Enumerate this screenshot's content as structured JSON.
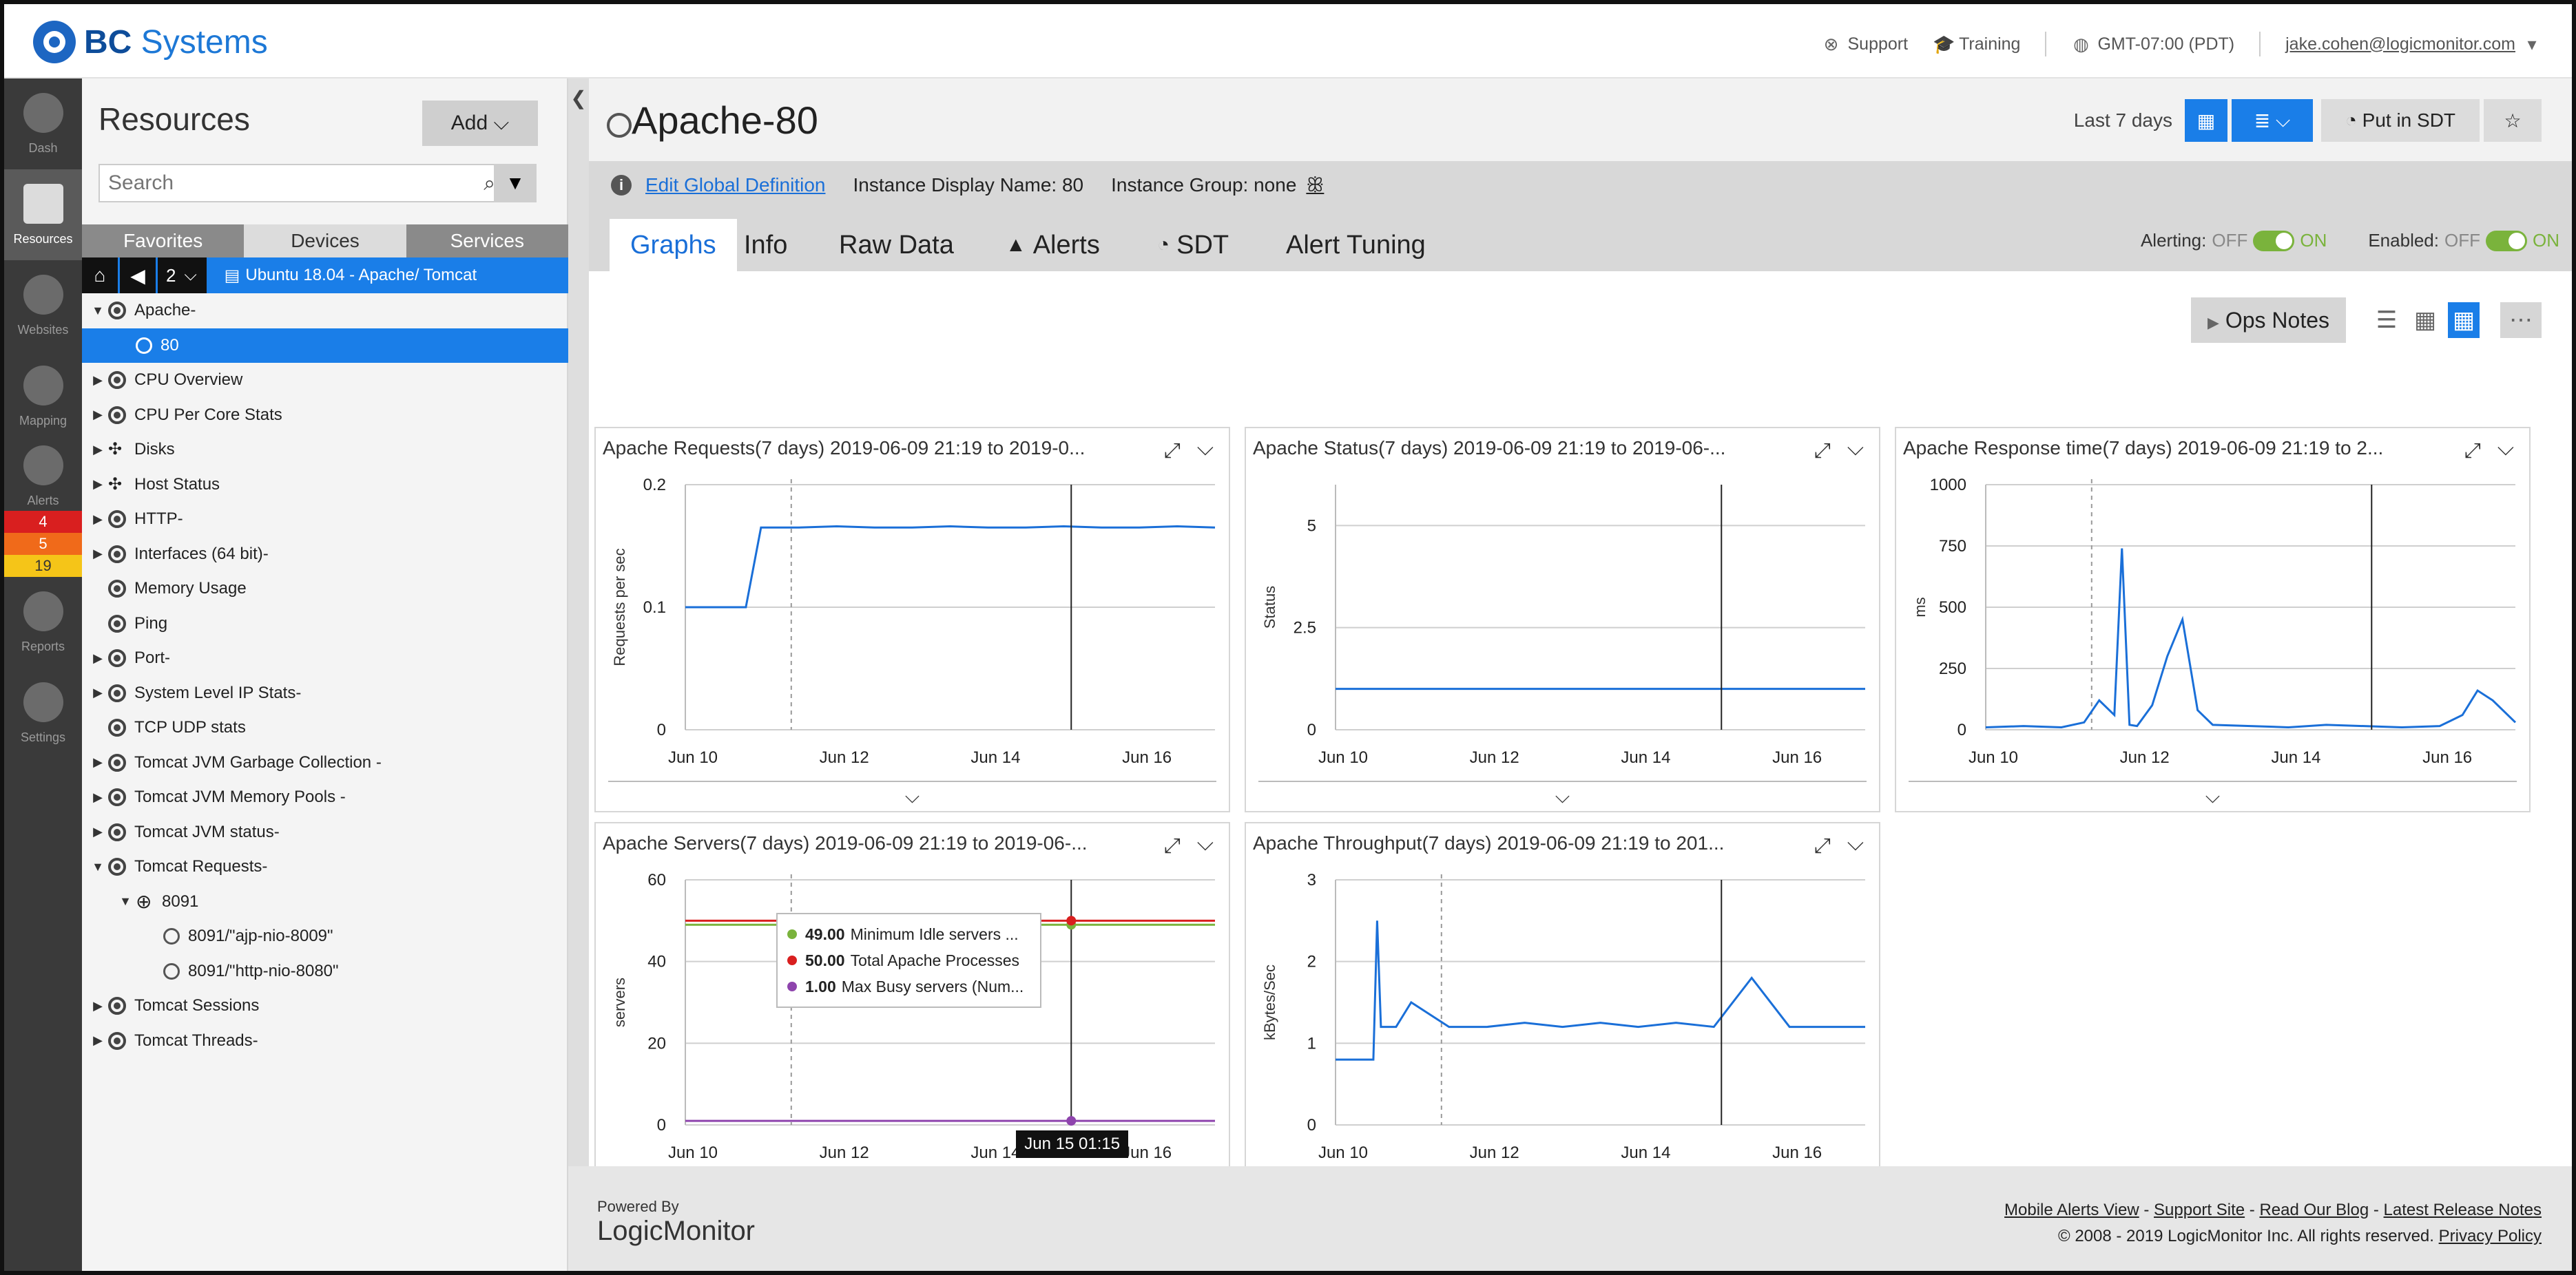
{
  "header": {
    "brand_bold": "BC",
    "brand_light": "Systems",
    "support": "Support",
    "training": "Training",
    "timezone": "GMT-07:00 (PDT)",
    "user": "jake.cohen@logicmonitor.com"
  },
  "leftnav": {
    "items": [
      "Dash",
      "Resources",
      "Websites",
      "Mapping",
      "Alerts",
      "Reports",
      "Settings"
    ],
    "alert_counts": [
      "4",
      "5",
      "19"
    ],
    "alert_colors": [
      "#d91f1f",
      "#f06a1a",
      "#f5c518"
    ]
  },
  "resources": {
    "title": "Resources",
    "add_label": "Add",
    "search_placeholder": "Search",
    "tabs": [
      "Favorites",
      "Devices",
      "Services"
    ],
    "breadcrumb_count": "2",
    "breadcrumb_path": "Ubuntu 18.04 - Apache/ Tomcat",
    "tree": [
      {
        "label": "Apache-",
        "level": 0,
        "toggle": "down",
        "icon": "ds"
      },
      {
        "label": "80",
        "level": 1,
        "toggle": "",
        "icon": "inst",
        "selected": true
      },
      {
        "label": "CPU Overview",
        "level": 0,
        "toggle": "right",
        "icon": "ds"
      },
      {
        "label": "CPU Per Core Stats",
        "level": 0,
        "toggle": "right",
        "icon": "ds"
      },
      {
        "label": "Disks",
        "level": 0,
        "toggle": "right",
        "icon": "dots"
      },
      {
        "label": "Host Status",
        "level": 0,
        "toggle": "right",
        "icon": "dots"
      },
      {
        "label": "HTTP-",
        "level": 0,
        "toggle": "right",
        "icon": "ds"
      },
      {
        "label": "Interfaces (64 bit)-",
        "level": 0,
        "toggle": "right",
        "icon": "ds"
      },
      {
        "label": "Memory Usage",
        "level": 0,
        "toggle": "",
        "icon": "ds"
      },
      {
        "label": "Ping",
        "level": 0,
        "toggle": "",
        "icon": "ds"
      },
      {
        "label": "Port-",
        "level": 0,
        "toggle": "right",
        "icon": "ds"
      },
      {
        "label": "System Level IP Stats-",
        "level": 0,
        "toggle": "right",
        "icon": "ds"
      },
      {
        "label": "TCP UDP stats",
        "level": 0,
        "toggle": "",
        "icon": "ds"
      },
      {
        "label": "Tomcat JVM Garbage Collection -",
        "level": 0,
        "toggle": "right",
        "icon": "ds"
      },
      {
        "label": "Tomcat JVM Memory Pools -",
        "level": 0,
        "toggle": "right",
        "icon": "ds"
      },
      {
        "label": "Tomcat JVM status-",
        "level": 0,
        "toggle": "right",
        "icon": "ds"
      },
      {
        "label": "Tomcat Requests-",
        "level": 0,
        "toggle": "down",
        "icon": "ds"
      },
      {
        "label": "8091",
        "level": 1,
        "toggle": "down",
        "icon": "group"
      },
      {
        "label": "8091/\"ajp-nio-8009\"",
        "level": 2,
        "toggle": "",
        "icon": "inst"
      },
      {
        "label": "8091/\"http-nio-8080\"",
        "level": 2,
        "toggle": "",
        "icon": "inst"
      },
      {
        "label": "Tomcat Sessions",
        "level": 0,
        "toggle": "right",
        "icon": "ds"
      },
      {
        "label": "Tomcat Threads-",
        "level": 0,
        "toggle": "right",
        "icon": "ds"
      }
    ]
  },
  "main": {
    "title": "Apache-80",
    "time_range": "Last 7 days",
    "sdt_button": "Put in SDT",
    "edit_link": "Edit Global Definition",
    "instance_display": "Instance Display Name: 80",
    "instance_group": "Instance Group: none",
    "tabs": [
      "Graphs",
      "Info",
      "Raw Data",
      "Alerts",
      "SDT",
      "Alert Tuning"
    ],
    "alerting_label": "Alerting:",
    "enabled_label": "Enabled:",
    "off": "OFF",
    "on": "ON",
    "ops_notes": "Ops Notes"
  },
  "chart_data": [
    {
      "type": "line",
      "title": "Apache Requests(7 days) 2019-06-09 21:19 to 2019-0...",
      "ylabel": "Requests per sec",
      "ylim": [
        0,
        0.2
      ],
      "yticks": [
        "0",
        "0.1",
        "0.2"
      ],
      "xticks": [
        "Jun 10",
        "Jun 12",
        "Jun 14",
        "Jun 16"
      ],
      "x": [
        0,
        0.3,
        0.6,
        0.8,
        1,
        1.5,
        2,
        2.5,
        3,
        3.5,
        4,
        4.5,
        5,
        5.5,
        6,
        6.5,
        7
      ],
      "series": [
        {
          "color": "#1a6fd8",
          "values": [
            0.1,
            0.1,
            0.1,
            0.1,
            0.165,
            0.165,
            0.166,
            0.165,
            0.165,
            0.166,
            0.165,
            0.165,
            0.166,
            0.165,
            0.165,
            0.166,
            0.165
          ]
        }
      ]
    },
    {
      "type": "line",
      "title": "Apache Status(7 days) 2019-06-09 21:19 to 2019-06-...",
      "ylabel": "Status",
      "ylim": [
        0,
        6
      ],
      "yticks": [
        "0",
        "2.5",
        "5"
      ],
      "xticks": [
        "Jun 10",
        "Jun 12",
        "Jun 14",
        "Jun 16"
      ],
      "x": [
        0,
        7
      ],
      "series": [
        {
          "color": "#1a6fd8",
          "values": [
            1,
            1
          ]
        }
      ]
    },
    {
      "type": "line",
      "title": "Apache Response time(7 days) 2019-06-09 21:19 to 2...",
      "ylabel": "ms",
      "ylim": [
        0,
        1000
      ],
      "yticks": [
        "0",
        "250",
        "500",
        "750",
        "1000"
      ],
      "xticks": [
        "Jun 10",
        "Jun 12",
        "Jun 14",
        "Jun 16"
      ],
      "x": [
        0,
        0.5,
        1,
        1.3,
        1.5,
        1.7,
        1.8,
        1.9,
        2,
        2.2,
        2.4,
        2.6,
        2.8,
        3,
        3.5,
        4,
        4.5,
        5,
        5.5,
        6,
        6.3,
        6.5,
        6.7,
        7
      ],
      "series": [
        {
          "color": "#1a6fd8",
          "values": [
            10,
            15,
            10,
            30,
            120,
            60,
            740,
            20,
            15,
            100,
            300,
            450,
            80,
            20,
            15,
            10,
            20,
            15,
            10,
            15,
            60,
            160,
            120,
            30
          ]
        }
      ]
    },
    {
      "type": "line",
      "title": "Apache Servers(7 days) 2019-06-09 21:19 to 2019-06-...",
      "ylabel": "servers",
      "ylim": [
        0,
        60
      ],
      "yticks": [
        "0",
        "20",
        "40",
        "60"
      ],
      "xticks": [
        "Jun 10",
        "Jun 12",
        "Jun 14",
        "Jun 16"
      ],
      "x": [
        0,
        7
      ],
      "series": [
        {
          "name": "Minimum Idle servers ...",
          "color": "#7ab33c",
          "values": [
            49,
            49
          ]
        },
        {
          "name": "Total Apache Processes",
          "color": "#d91f1f",
          "values": [
            50,
            50
          ]
        },
        {
          "name": "Max Busy servers (Num...",
          "color": "#8e44ad",
          "values": [
            1,
            1
          ]
        }
      ],
      "tooltip": {
        "values": [
          "49.00",
          "50.00",
          "1.00"
        ],
        "time": "Jun 15 01:15"
      }
    },
    {
      "type": "line",
      "title": "Apache Throughput(7 days) 2019-06-09 21:19 to 201...",
      "ylabel": "kBytes/Sec",
      "ylim": [
        0,
        3
      ],
      "yticks": [
        "0",
        "1",
        "2",
        "3"
      ],
      "xticks": [
        "Jun 10",
        "Jun 12",
        "Jun 14",
        "Jun 16"
      ],
      "x": [
        0,
        0.3,
        0.5,
        0.55,
        0.6,
        0.8,
        1,
        1.5,
        2,
        2.5,
        3,
        3.5,
        4,
        4.5,
        5,
        5.5,
        6,
        6.5,
        7
      ],
      "series": [
        {
          "color": "#1a6fd8",
          "values": [
            0.8,
            0.8,
            0.8,
            2.5,
            1.2,
            1.2,
            1.5,
            1.2,
            1.2,
            1.25,
            1.2,
            1.25,
            1.2,
            1.25,
            1.2,
            1.8,
            1.2,
            1.2,
            1.2
          ]
        }
      ]
    }
  ],
  "footer": {
    "powered_by": "Powered By",
    "brand": "LogicMonitor",
    "links": [
      "Mobile Alerts View",
      "Support Site",
      "Read Our Blog",
      "Latest Release Notes"
    ],
    "copyright": "© 2008 - 2019 LogicMonitor Inc. All rights reserved.",
    "privacy": "Privacy Policy"
  }
}
